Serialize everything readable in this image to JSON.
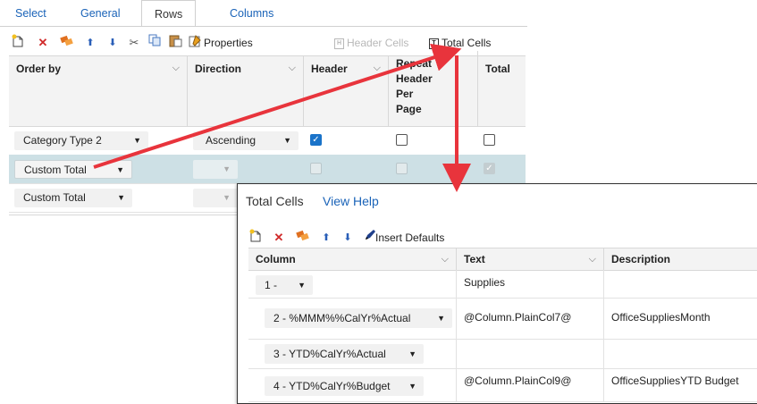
{
  "tabs": [
    {
      "label": "Select"
    },
    {
      "label": "General"
    },
    {
      "label": "Rows"
    },
    {
      "label": "Columns"
    }
  ],
  "toolbar": {
    "properties_label": "Properties",
    "header_cells_label": "Header Cells",
    "total_cells_label": "Total Cells",
    "icons": [
      "new-icon",
      "delete-icon",
      "clear-icon",
      "move-up-icon",
      "move-down-icon",
      "cut-icon",
      "copy-icon",
      "paste-icon",
      "properties-icon",
      "header-cells-icon",
      "total-cells-icon"
    ]
  },
  "grid": {
    "columns": [
      "Order by",
      "Direction",
      "Header",
      "Repeat Header Per Page",
      "Total"
    ],
    "repeat_header_lines": [
      "Repeat",
      "Header",
      "Per",
      "Page"
    ],
    "rows": [
      {
        "order_by": "Category Type 2",
        "direction": "Ascending",
        "header": true,
        "repeat": false,
        "total": false
      },
      {
        "order_by": "Custom Total",
        "direction": "",
        "header": false,
        "repeat": false,
        "total": true
      },
      {
        "order_by": "Custom Total",
        "direction": "",
        "header": false,
        "repeat": false,
        "total": false
      }
    ]
  },
  "popup": {
    "title": "Total Cells",
    "help_link": "View Help",
    "insert_defaults_label": "Insert Defaults",
    "columns": [
      "Column",
      "Text",
      "Description"
    ],
    "rows": [
      {
        "column": "1 -",
        "text": "Supplies",
        "description": ""
      },
      {
        "column": "2 - %MMM%%CalYr%Actual",
        "text": "@Column.PlainCol7@",
        "description": "OfficeSuppliesMonth"
      },
      {
        "column": "3 - YTD%CalYr%Actual",
        "text": "",
        "description": ""
      },
      {
        "column": "4 - YTD%CalYr%Budget",
        "text": "@Column.PlainCol9@",
        "description": "OfficeSuppliesYTD Budget"
      }
    ]
  },
  "colors": {
    "accent_link": "#1a63b8",
    "checkbox_on": "#1a73c9",
    "selected_row": "#cde0e5",
    "arrow": "#e8343c"
  }
}
